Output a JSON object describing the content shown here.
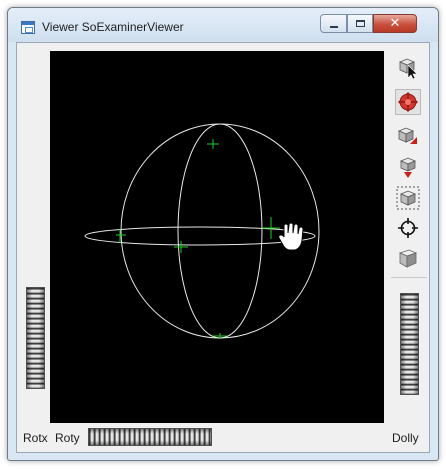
{
  "window": {
    "title": "Viewer SoExaminerViewer",
    "controls": {
      "minimize": "minimize",
      "maximize": "maximize",
      "close": "close"
    }
  },
  "toolbar": {
    "items": [
      {
        "name": "pick-mode",
        "icon": "arrow-cursor-icon",
        "active": false
      },
      {
        "name": "view-mode",
        "icon": "rotate-view-icon",
        "active": true
      },
      {
        "name": "home",
        "icon": "home-view-icon",
        "active": false
      },
      {
        "name": "set-home",
        "icon": "set-home-view-icon",
        "active": false
      },
      {
        "name": "view-all",
        "icon": "view-all-icon",
        "active": false
      },
      {
        "name": "seek",
        "icon": "seek-crosshair-icon",
        "active": false
      },
      {
        "name": "projection",
        "icon": "perspective-cube-icon",
        "active": false
      }
    ]
  },
  "wheels": {
    "rotx_label": "Rotx",
    "roty_label": "Roty",
    "dolly_label": "Dolly"
  },
  "colors": {
    "viewport_background": "#000000",
    "sphere_wireframe": "#ffffff",
    "trackball_markers": "#22cc22",
    "active_tool_highlight": "#d0342c"
  }
}
